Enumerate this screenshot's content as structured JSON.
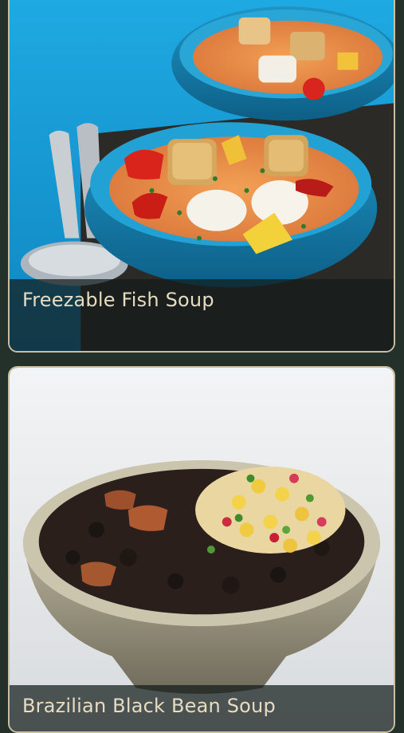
{
  "recipes": [
    {
      "title": "Freezable Fish Soup",
      "image_icon": "fish-soup-photo",
      "accent": "#1aa0d8"
    },
    {
      "title": "Brazilian Black Bean Soup",
      "image_icon": "black-bean-soup-photo",
      "accent": "#eef0f2"
    }
  ],
  "colors": {
    "background": "#24302a",
    "card_border": "#c9bea2",
    "caption_text": "#e6dcc2"
  }
}
